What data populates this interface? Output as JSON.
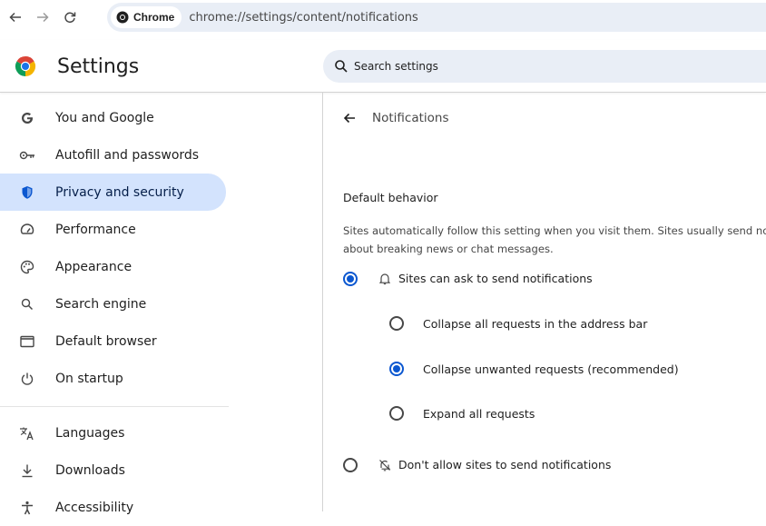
{
  "browser": {
    "chip_label": "Chrome",
    "url": "chrome://settings/content/notifications",
    "icons": [
      "back-arrow-icon",
      "forward-arrow-icon",
      "reload-icon",
      "chrome-logo-icon"
    ]
  },
  "header": {
    "title": "Settings",
    "search_placeholder": "Search settings"
  },
  "sidebar": {
    "items": [
      {
        "label": "You and Google",
        "icon": "google-g-icon"
      },
      {
        "label": "Autofill and passwords",
        "icon": "key-icon"
      },
      {
        "label": "Privacy and security",
        "icon": "shield-icon",
        "selected": true
      },
      {
        "label": "Performance",
        "icon": "speedometer-icon"
      },
      {
        "label": "Appearance",
        "icon": "palette-icon"
      },
      {
        "label": "Search engine",
        "icon": "search-icon"
      },
      {
        "label": "Default browser",
        "icon": "browser-window-icon"
      },
      {
        "label": "On startup",
        "icon": "power-icon"
      },
      {
        "label": "Languages",
        "icon": "translate-icon"
      },
      {
        "label": "Downloads",
        "icon": "download-icon"
      },
      {
        "label": "Accessibility",
        "icon": "accessibility-icon"
      }
    ]
  },
  "main": {
    "page_title": "Notifications",
    "section_title": "Default behavior",
    "description_line1": "Sites automatically follow this setting when you visit them. Sites usually send no",
    "description_line2": "about breaking news or chat messages.",
    "options": {
      "ask": {
        "label": "Sites can ask to send notifications",
        "checked": true
      },
      "collapse_all": {
        "label": "Collapse all requests in the address bar",
        "checked": false
      },
      "collapse_unwanted": {
        "label": "Collapse unwanted requests (recommended)",
        "checked": true
      },
      "expand_all": {
        "label": "Expand all requests",
        "checked": false
      },
      "dont_allow": {
        "label": "Don't allow sites to send notifications",
        "checked": false
      }
    }
  },
  "colors": {
    "accent": "#0b57d0",
    "selected_bg": "#d3e3fd",
    "omnibox_bg": "#e9eef6"
  }
}
